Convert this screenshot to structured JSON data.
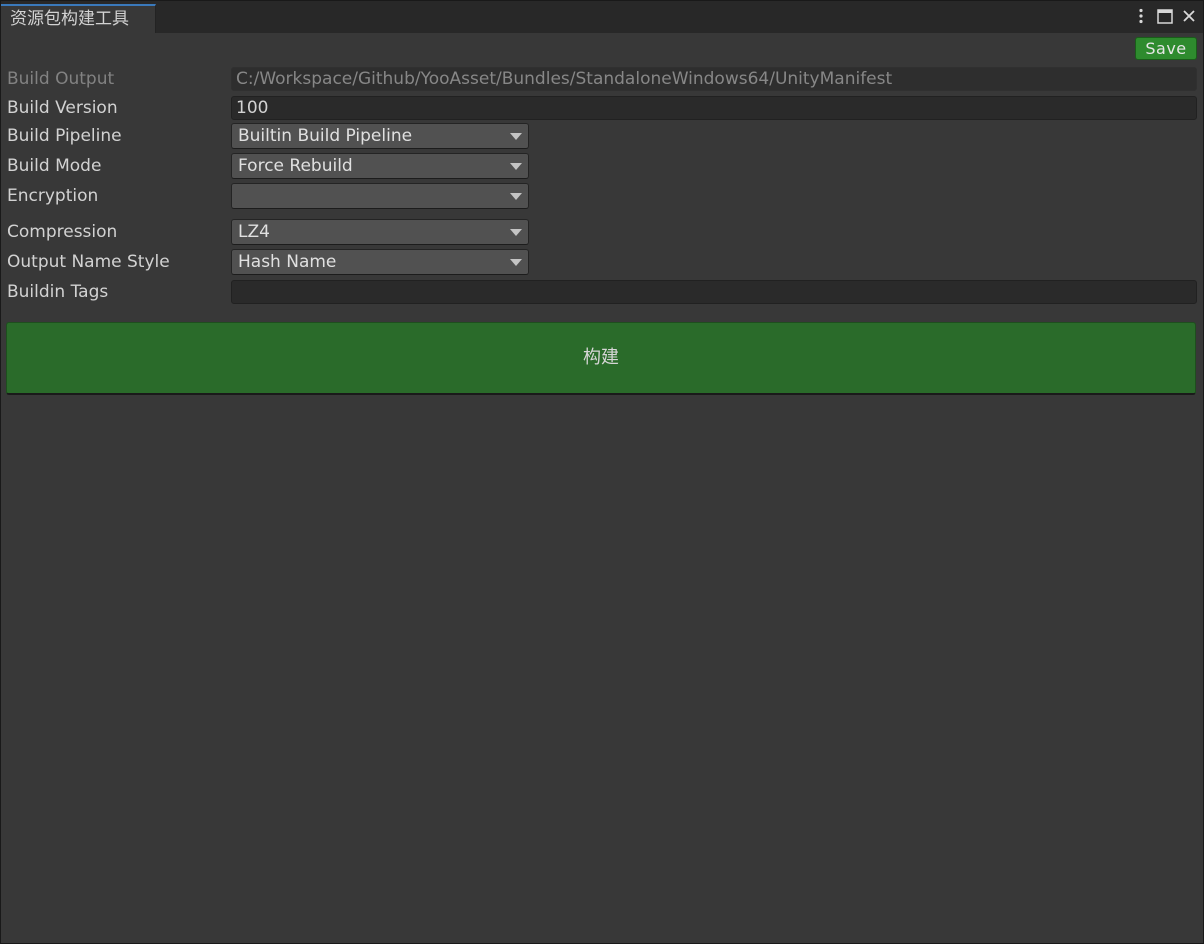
{
  "window": {
    "tab_title": "资源包构建工具",
    "controls": [
      "more-options-icon",
      "maximize-icon",
      "close-icon"
    ]
  },
  "toolbar": {
    "save_label": "Save"
  },
  "form": {
    "build_output": {
      "label": "Build Output",
      "value": "C:/Workspace/Github/YooAsset/Bundles/StandaloneWindows64/UnityManifest"
    },
    "build_version": {
      "label": "Build Version",
      "value": "100"
    },
    "build_pipeline": {
      "label": "Build Pipeline",
      "value": "Builtin Build Pipeline"
    },
    "build_mode": {
      "label": "Build Mode",
      "value": "Force Rebuild"
    },
    "encryption": {
      "label": "Encryption",
      "value": ""
    },
    "compression": {
      "label": "Compression",
      "value": "LZ4"
    },
    "output_name_style": {
      "label": "Output Name Style",
      "value": "Hash Name"
    },
    "buildin_tags": {
      "label": "Buildin Tags",
      "value": ""
    }
  },
  "build_button": {
    "label": "构建"
  },
  "colors": {
    "background": "#383838",
    "tab_accent": "#3a79bb",
    "save_button": "#2e8b2e",
    "build_button": "#2a6b2a"
  }
}
